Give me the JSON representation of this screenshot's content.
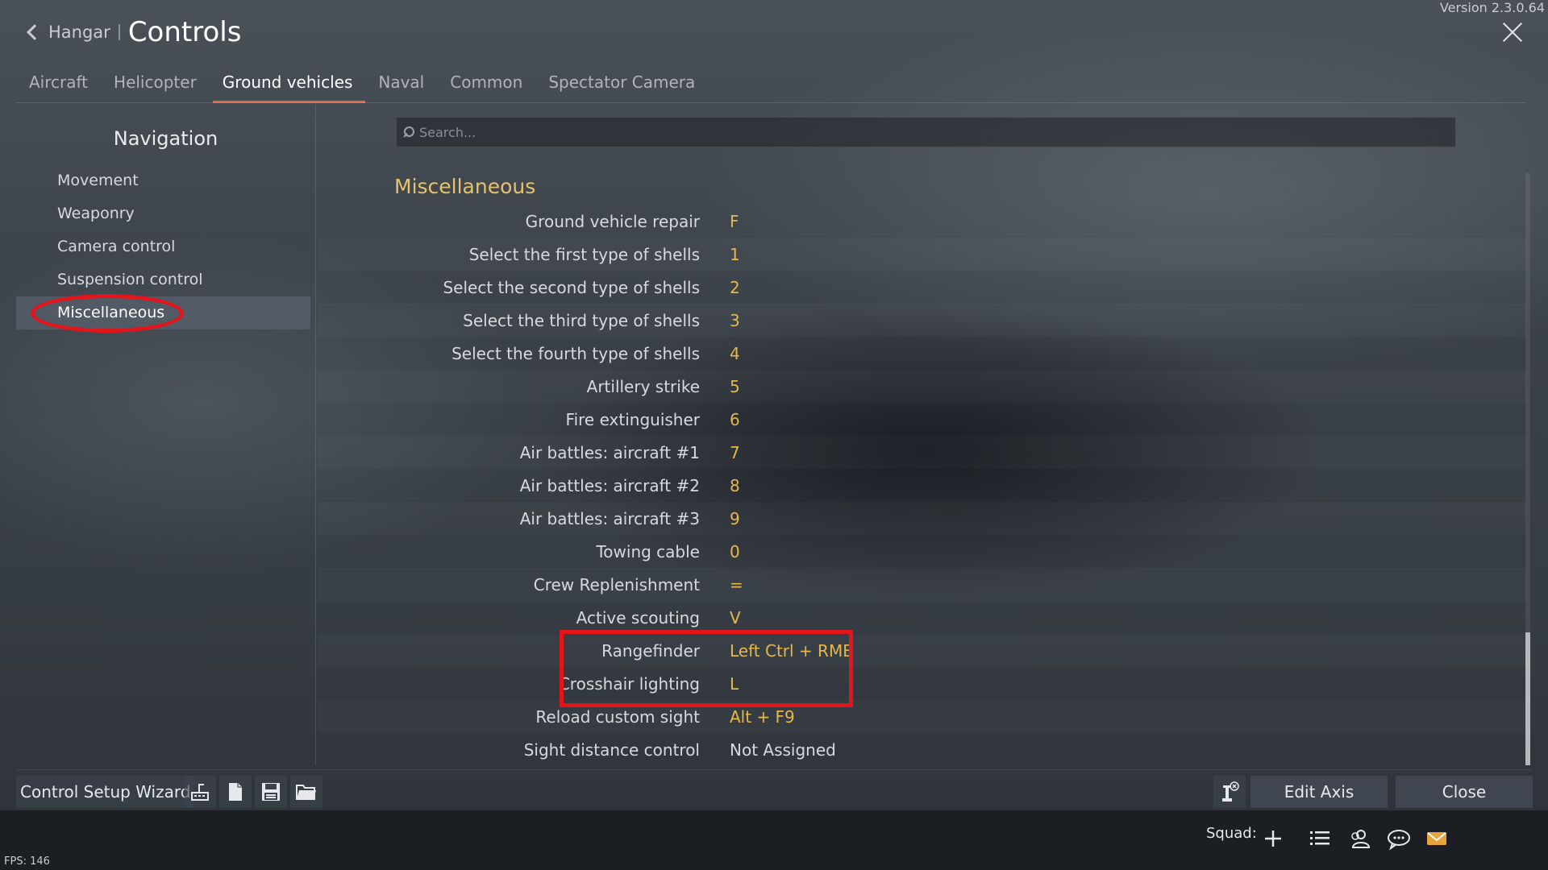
{
  "version": "Version 2.3.0.64",
  "header": {
    "back_label": "Hangar",
    "title": "Controls"
  },
  "tabs": [
    {
      "label": "Aircraft"
    },
    {
      "label": "Helicopter"
    },
    {
      "label": "Ground vehicles"
    },
    {
      "label": "Naval"
    },
    {
      "label": "Common"
    },
    {
      "label": "Spectator Camera"
    }
  ],
  "nav": {
    "title": "Navigation",
    "items": [
      {
        "label": "Movement"
      },
      {
        "label": "Weaponry"
      },
      {
        "label": "Camera control"
      },
      {
        "label": "Suspension control"
      },
      {
        "label": "Miscellaneous"
      }
    ]
  },
  "search": {
    "placeholder": "Search..."
  },
  "section": {
    "title": "Miscellaneous",
    "rows": [
      {
        "label": "Ground vehicle repair",
        "key": "F"
      },
      {
        "label": "Select the first type of shells",
        "key": "1"
      },
      {
        "label": "Select the second type of shells",
        "key": "2"
      },
      {
        "label": "Select the third type of shells",
        "key": "3"
      },
      {
        "label": "Select the fourth type of shells",
        "key": "4"
      },
      {
        "label": "Artillery strike",
        "key": "5"
      },
      {
        "label": "Fire extinguisher",
        "key": "6"
      },
      {
        "label": "Air battles: aircraft #1",
        "key": "7"
      },
      {
        "label": "Air battles: aircraft #2",
        "key": "8"
      },
      {
        "label": "Air battles: aircraft #3",
        "key": "9"
      },
      {
        "label": "Towing cable",
        "key": "0"
      },
      {
        "label": "Crew Replenishment",
        "key": "="
      },
      {
        "label": "Active scouting",
        "key": "V"
      },
      {
        "label": "Rangefinder",
        "key": "Left Ctrl + RMB"
      },
      {
        "label": "Crosshair lighting",
        "key": "L"
      },
      {
        "label": "Reload custom sight",
        "key": "Alt + F9"
      },
      {
        "label": "Sight distance control",
        "key": "Not Assigned"
      }
    ]
  },
  "bottom": {
    "wizard_label": "Control Setup Wizard",
    "edit_axis_label": "Edit Axis",
    "close_label": "Close"
  },
  "footer": {
    "squad_label": "Squad:",
    "fps": "FPS: 146"
  },
  "colors": {
    "accent": "#e6b84a",
    "tab_underline": "#d96a4a",
    "highlight": "#e4141b"
  }
}
